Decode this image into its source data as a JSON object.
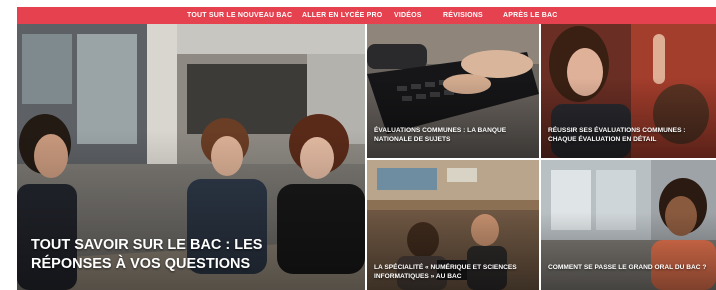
{
  "nav": {
    "items": [
      "TOUT SUR LE NOUVEAU BAC",
      "ALLER EN LYCÉE PRO",
      "VIDÉOS",
      "RÉVISIONS",
      "APRÈS LE BAC"
    ],
    "color": "#e5414e"
  },
  "tiles": {
    "hero": {
      "caption": "TOUT SAVOIR SUR LE BAC : LES RÉPONSES À VOS QUESTIONS"
    },
    "keyboard": {
      "caption": "ÉVALUATIONS COMMUNES : LA BANQUE NATIONALE DE SUJETS"
    },
    "raise": {
      "caption": "RÉUSSIR SES ÉVALUATIONS COMMUNES : CHAQUE ÉVALUATION EN DÉTAIL"
    },
    "nsi": {
      "caption": "LA SPÉCIALITÉ « NUMÉRIQUE ET SCIENCES INFORMATIQUES » AU BAC"
    },
    "oral": {
      "caption": "COMMENT SE PASSE LE GRAND ORAL DU BAC ?"
    }
  }
}
